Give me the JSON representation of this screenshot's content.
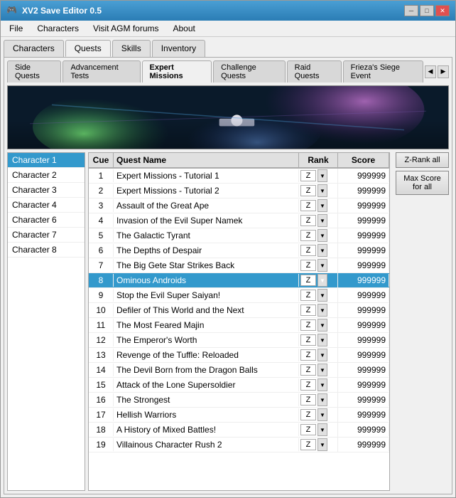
{
  "window": {
    "title": "XV2 Save Editor 0.5",
    "icon": "🎮"
  },
  "menu": {
    "items": [
      "File",
      "Characters",
      "Visit AGM forums",
      "About"
    ]
  },
  "main_tabs": [
    {
      "label": "Characters",
      "active": false
    },
    {
      "label": "Quests",
      "active": true
    },
    {
      "label": "Skills",
      "active": false
    },
    {
      "label": "Inventory",
      "active": false
    }
  ],
  "sub_tabs": [
    {
      "label": "Side Quests",
      "active": false
    },
    {
      "label": "Advancement Tests",
      "active": false
    },
    {
      "label": "Expert Missions",
      "active": true
    },
    {
      "label": "Challenge Quests",
      "active": false
    },
    {
      "label": "Raid Quests",
      "active": false
    },
    {
      "label": "Frieza's Siege Event",
      "active": false
    }
  ],
  "characters": [
    {
      "label": "Character 1",
      "active": true
    },
    {
      "label": "Character 2",
      "active": false
    },
    {
      "label": "Character 3",
      "active": false
    },
    {
      "label": "Character 4",
      "active": false
    },
    {
      "label": "Character 6",
      "active": false
    },
    {
      "label": "Character 7",
      "active": false
    },
    {
      "label": "Character 8",
      "active": false
    }
  ],
  "table": {
    "headers": {
      "cue": "Cue",
      "name": "Quest Name",
      "rank": "Rank",
      "score": "Score"
    },
    "rows": [
      {
        "cue": 1,
        "name": "Expert Missions - Tutorial 1",
        "rank": "Z",
        "score": "999999",
        "highlighted": false
      },
      {
        "cue": 2,
        "name": "Expert Missions - Tutorial 2",
        "rank": "Z",
        "score": "999999",
        "highlighted": false
      },
      {
        "cue": 3,
        "name": "Assault of the Great Ape",
        "rank": "Z",
        "score": "999999",
        "highlighted": false
      },
      {
        "cue": 4,
        "name": "Invasion of the Evil Super Namek",
        "rank": "Z",
        "score": "999999",
        "highlighted": false
      },
      {
        "cue": 5,
        "name": "The Galactic Tyrant",
        "rank": "Z",
        "score": "999999",
        "highlighted": false
      },
      {
        "cue": 6,
        "name": "The Depths of Despair",
        "rank": "Z",
        "score": "999999",
        "highlighted": false
      },
      {
        "cue": 7,
        "name": "The Big Gete Star Strikes Back",
        "rank": "Z",
        "score": "999999",
        "highlighted": false
      },
      {
        "cue": 8,
        "name": "Ominous Androids",
        "rank": "Z",
        "score": "999999",
        "highlighted": true
      },
      {
        "cue": 9,
        "name": "Stop the Evil Super Saiyan!",
        "rank": "Z",
        "score": "999999",
        "highlighted": false
      },
      {
        "cue": 10,
        "name": "Defiler of This World and the Next",
        "rank": "Z",
        "score": "999999",
        "highlighted": false
      },
      {
        "cue": 11,
        "name": "The Most Feared Majin",
        "rank": "Z",
        "score": "999999",
        "highlighted": false
      },
      {
        "cue": 12,
        "name": "The Emperor&apos;s Worth",
        "rank": "Z",
        "score": "999999",
        "highlighted": false
      },
      {
        "cue": 13,
        "name": "Revenge of the Tuffle: Reloaded",
        "rank": "Z",
        "score": "999999",
        "highlighted": false
      },
      {
        "cue": 14,
        "name": "The Devil Born from the Dragon Balls",
        "rank": "Z",
        "score": "999999",
        "highlighted": false
      },
      {
        "cue": 15,
        "name": "Attack of the Lone Supersoldier",
        "rank": "Z",
        "score": "999999",
        "highlighted": false
      },
      {
        "cue": 16,
        "name": "The Strongest",
        "rank": "Z",
        "score": "999999",
        "highlighted": false
      },
      {
        "cue": 17,
        "name": "Hellish Warriors",
        "rank": "Z",
        "score": "999999",
        "highlighted": false
      },
      {
        "cue": 18,
        "name": "A History of Mixed Battles!",
        "rank": "Z",
        "score": "999999",
        "highlighted": false
      },
      {
        "cue": 19,
        "name": "Villainous Character Rush 2",
        "rank": "Z",
        "score": "999999",
        "highlighted": false
      }
    ]
  },
  "buttons": {
    "z_rank_all": "Z-Rank all",
    "max_score": "Max Score\nfor all"
  },
  "colors": {
    "active_tab": "#3399cc",
    "highlight_row": "#3399cc",
    "selected_char": "#3399cc"
  }
}
